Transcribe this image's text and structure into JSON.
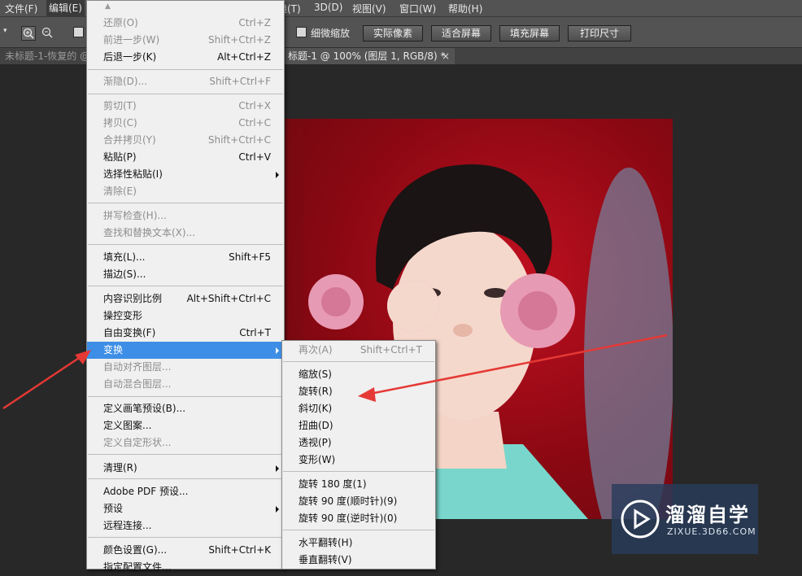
{
  "menubar": {
    "items": [
      "文件(F)",
      "编辑(E)",
      "滤镜(T)",
      "3D(D)",
      "视图(V)",
      "窗口(W)",
      "帮助(H)"
    ],
    "visible_partials": {
      "filter": "镜(T)"
    }
  },
  "options": {
    "fine_zoom": "细微缩放",
    "actual_pixels": "实际像素",
    "fit_screen": "适合屏幕",
    "fill_screen": "填充屏幕",
    "print_size": "打印尺寸"
  },
  "tabs": {
    "tab1": "未标题-1-恢复的 @",
    "tab2": "标题-1 @ 100% (图层 1, RGB/8) *",
    "close": "×"
  },
  "edit_menu": {
    "items": [
      {
        "label": "还原(O)",
        "shortcut": "Ctrl+Z",
        "state": "disabled"
      },
      {
        "label": "前进一步(W)",
        "shortcut": "Shift+Ctrl+Z",
        "state": "disabled"
      },
      {
        "label": "后退一步(K)",
        "shortcut": "Alt+Ctrl+Z",
        "state": "enabled"
      },
      {
        "label": "渐隐(D)...",
        "shortcut": "Shift+Ctrl+F",
        "state": "disabled"
      },
      {
        "label": "剪切(T)",
        "shortcut": "Ctrl+X",
        "state": "disabled"
      },
      {
        "label": "拷贝(C)",
        "shortcut": "Ctrl+C",
        "state": "disabled"
      },
      {
        "label": "合并拷贝(Y)",
        "shortcut": "Shift+Ctrl+C",
        "state": "disabled"
      },
      {
        "label": "粘贴(P)",
        "shortcut": "Ctrl+V",
        "state": "enabled"
      },
      {
        "label": "选择性粘贴(I)",
        "shortcut": "",
        "state": "enabled",
        "submenu": true
      },
      {
        "label": "清除(E)",
        "shortcut": "",
        "state": "disabled"
      },
      {
        "label": "拼写检查(H)...",
        "shortcut": "",
        "state": "disabled"
      },
      {
        "label": "查找和替换文本(X)...",
        "shortcut": "",
        "state": "disabled"
      },
      {
        "label": "填充(L)...",
        "shortcut": "Shift+F5",
        "state": "enabled"
      },
      {
        "label": "描边(S)...",
        "shortcut": "",
        "state": "enabled"
      },
      {
        "label": "内容识别比例",
        "shortcut": "Alt+Shift+Ctrl+C",
        "state": "enabled"
      },
      {
        "label": "操控变形",
        "shortcut": "",
        "state": "enabled"
      },
      {
        "label": "自由变换(F)",
        "shortcut": "Ctrl+T",
        "state": "enabled"
      },
      {
        "label": "变换",
        "shortcut": "",
        "state": "highlighted",
        "submenu": true
      },
      {
        "label": "自动对齐图层...",
        "shortcut": "",
        "state": "disabled"
      },
      {
        "label": "自动混合图层...",
        "shortcut": "",
        "state": "disabled"
      },
      {
        "label": "定义画笔预设(B)...",
        "shortcut": "",
        "state": "enabled"
      },
      {
        "label": "定义图案...",
        "shortcut": "",
        "state": "enabled"
      },
      {
        "label": "定义自定形状...",
        "shortcut": "",
        "state": "disabled"
      },
      {
        "label": "清理(R)",
        "shortcut": "",
        "state": "enabled",
        "submenu": true
      },
      {
        "label": "Adobe PDF 预设...",
        "shortcut": "",
        "state": "enabled"
      },
      {
        "label": "预设",
        "shortcut": "",
        "state": "enabled",
        "submenu": true
      },
      {
        "label": "远程连接...",
        "shortcut": "",
        "state": "enabled"
      },
      {
        "label": "颜色设置(G)...",
        "shortcut": "Shift+Ctrl+K",
        "state": "enabled"
      },
      {
        "label": "指定配置文件...",
        "shortcut": "",
        "state": "enabled"
      }
    ]
  },
  "transform_menu": {
    "items": [
      {
        "label": "再次(A)",
        "shortcut": "Shift+Ctrl+T",
        "state": "disabled"
      },
      {
        "label": "缩放(S)",
        "shortcut": "",
        "state": "enabled"
      },
      {
        "label": "旋转(R)",
        "shortcut": "",
        "state": "enabled"
      },
      {
        "label": "斜切(K)",
        "shortcut": "",
        "state": "enabled"
      },
      {
        "label": "扭曲(D)",
        "shortcut": "",
        "state": "enabled"
      },
      {
        "label": "透视(P)",
        "shortcut": "",
        "state": "enabled"
      },
      {
        "label": "变形(W)",
        "shortcut": "",
        "state": "enabled"
      },
      {
        "label": "旋转 180 度(1)",
        "shortcut": "",
        "state": "enabled"
      },
      {
        "label": "旋转 90 度(顺时针)(9)",
        "shortcut": "",
        "state": "enabled"
      },
      {
        "label": "旋转 90 度(逆时针)(0)",
        "shortcut": "",
        "state": "enabled"
      },
      {
        "label": "水平翻转(H)",
        "shortcut": "",
        "state": "enabled"
      },
      {
        "label": "垂直翻转(V)",
        "shortcut": "",
        "state": "enabled"
      }
    ]
  },
  "watermark": {
    "brand": "溜溜自学",
    "url": "ZIXUE.3D66.COM"
  },
  "colors": {
    "highlight": "#3d8ee6",
    "arrow": "#e53935",
    "menu_bg": "#f0f0f0",
    "ui_bg": "#535353"
  }
}
